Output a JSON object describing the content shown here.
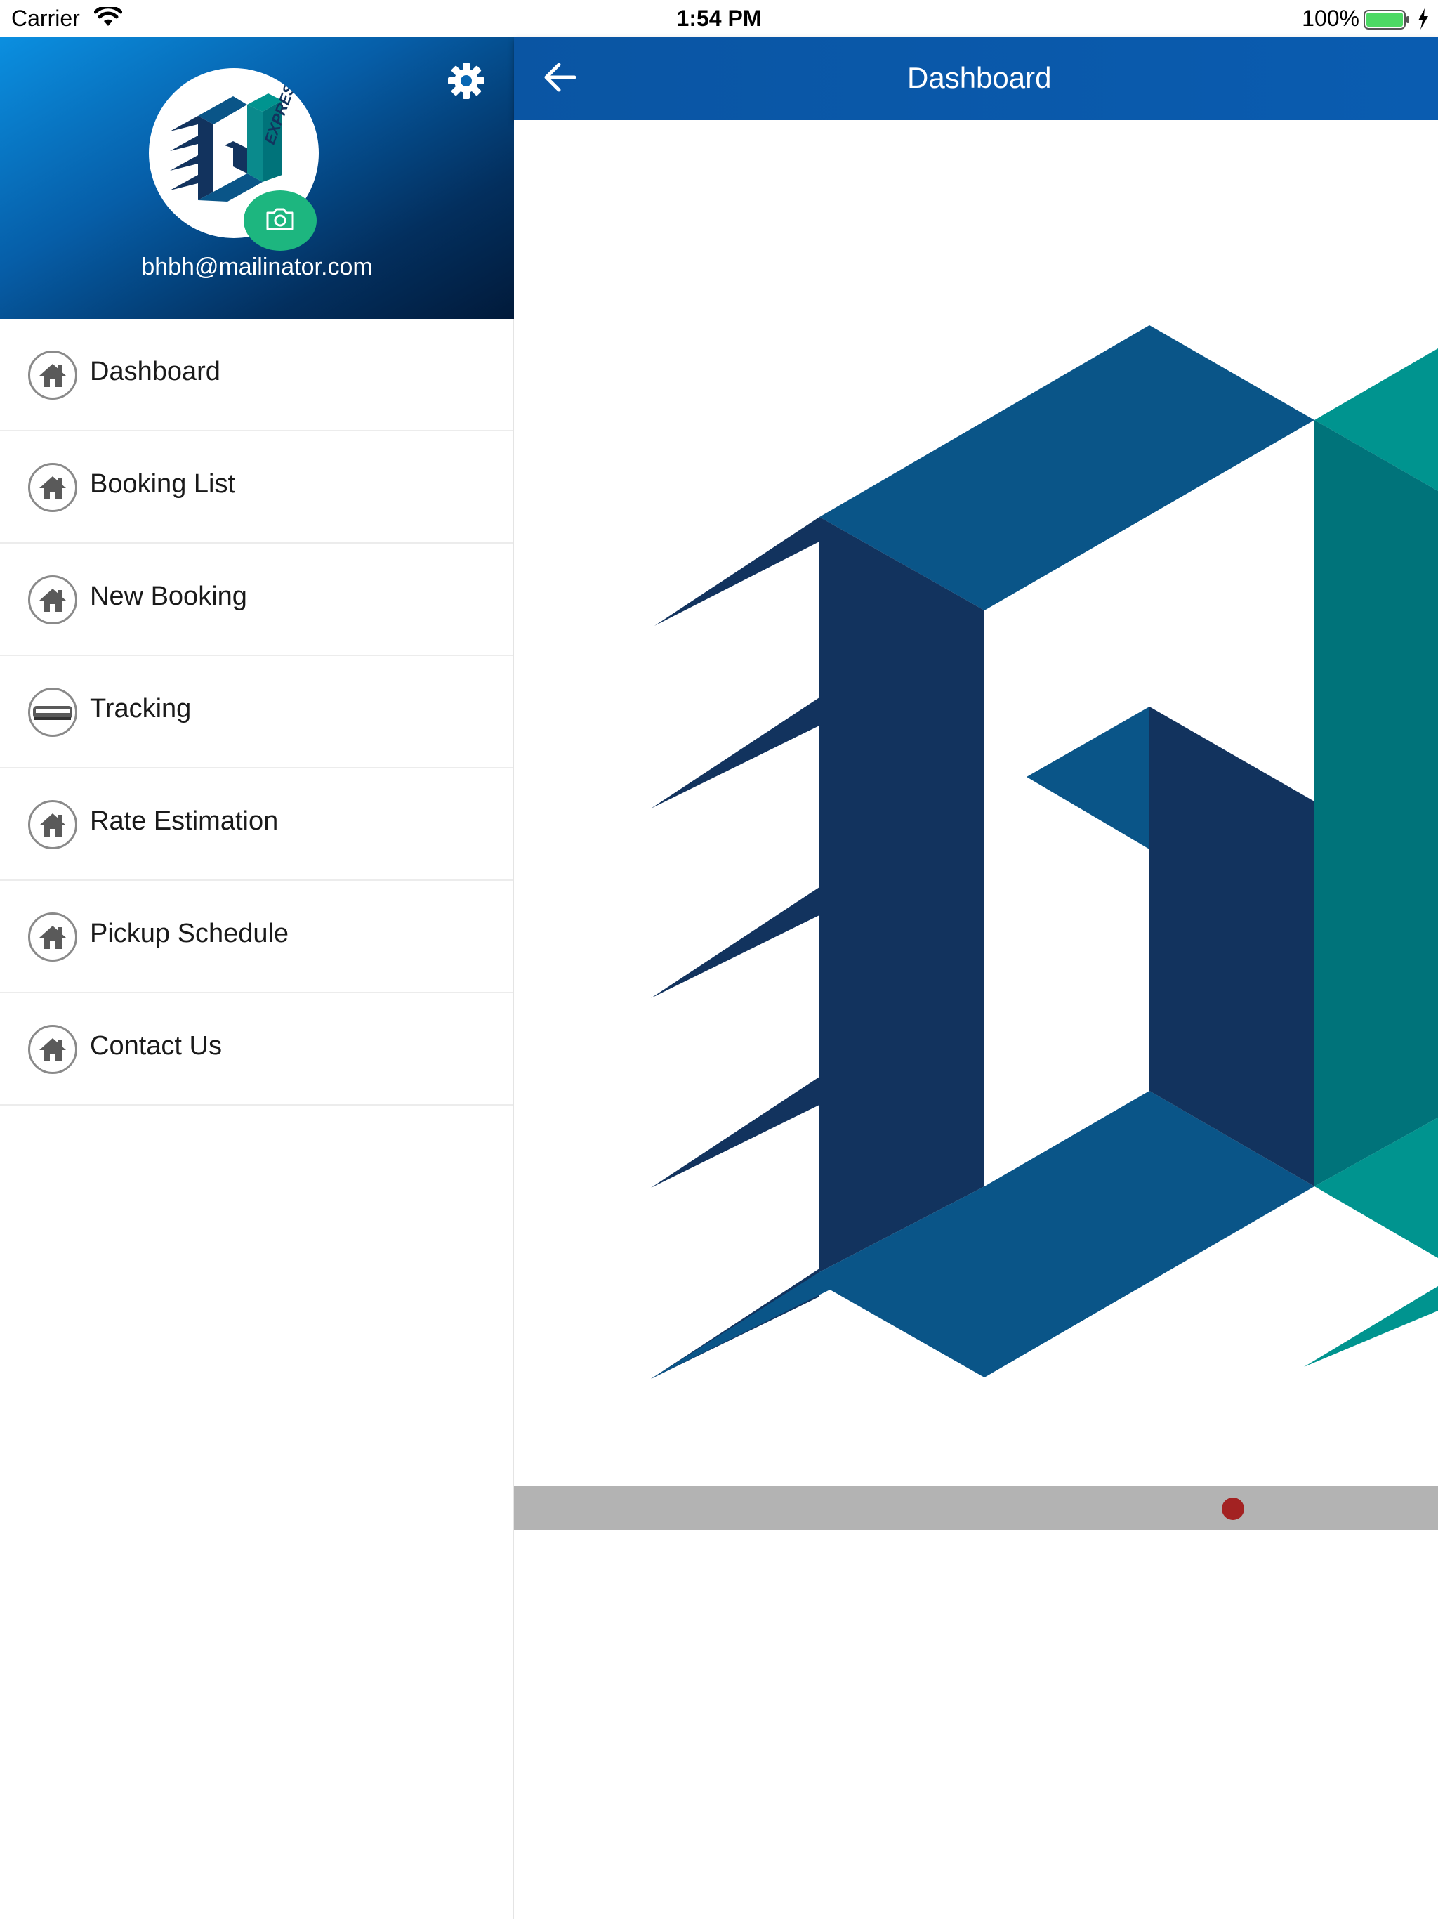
{
  "status_bar": {
    "carrier": "Carrier",
    "time": "1:54 PM",
    "battery": "100%"
  },
  "drawer": {
    "email": "bhbh@mailinator.com",
    "logo_text": "EXPRESS",
    "items": [
      {
        "label": "Dashboard",
        "icon": "home-icon"
      },
      {
        "label": "Booking List",
        "icon": "home-icon"
      },
      {
        "label": "New Booking",
        "icon": "home-icon"
      },
      {
        "label": "Tracking",
        "icon": "truck-icon"
      },
      {
        "label": "Rate Estimation",
        "icon": "home-icon"
      },
      {
        "label": "Pickup Schedule",
        "icon": "home-icon"
      },
      {
        "label": "Contact Us",
        "icon": "home-icon"
      }
    ]
  },
  "header": {
    "title": "Dashboard"
  },
  "colors": {
    "navbar": "#0a5cb0",
    "logo_dark": "#12335e",
    "logo_mid": "#0a5588",
    "logo_teal": "#00948f",
    "logo_teal_dark": "#00737a",
    "camera_badge": "#1db67f",
    "pager_dot": "#a32222"
  },
  "pager": {
    "current": 1
  }
}
